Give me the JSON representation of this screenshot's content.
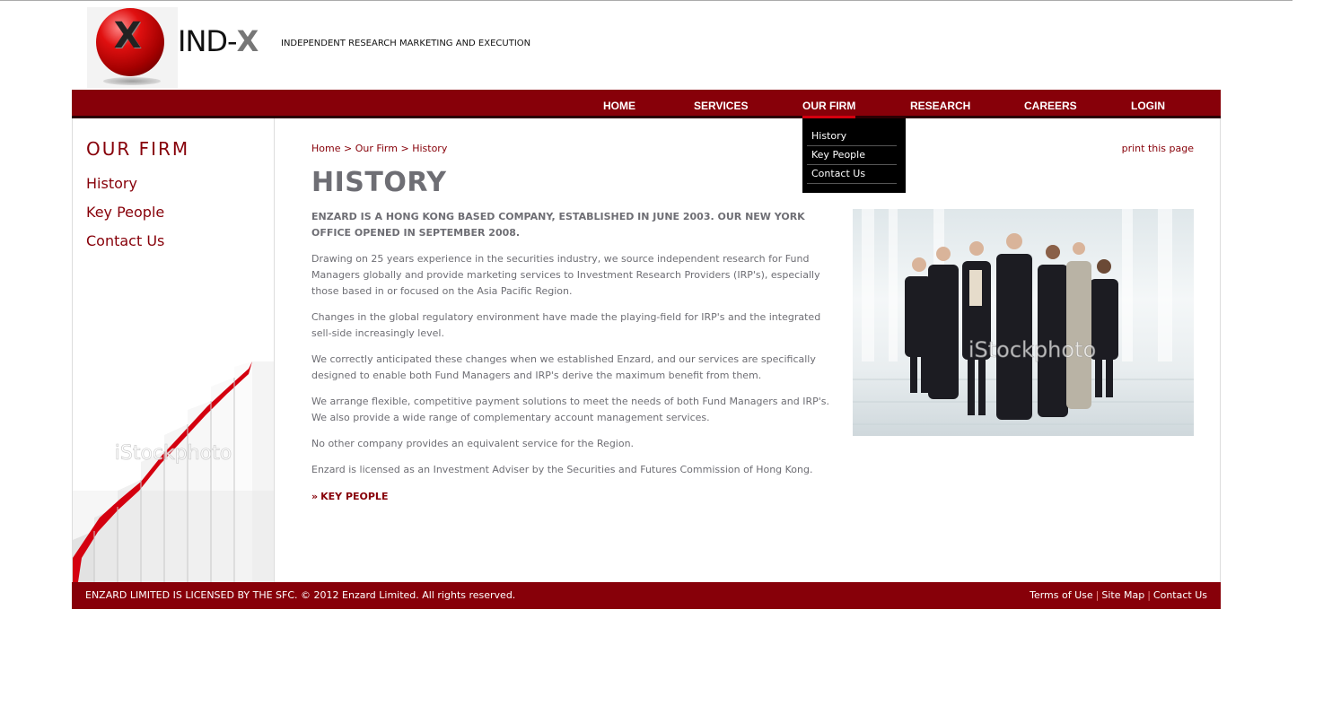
{
  "header": {
    "logo_mark": "X",
    "logo_name_main": "IND-",
    "logo_name_x": "X",
    "tagline": "INDEPENDENT RESEARCH MARKETING AND EXECUTION"
  },
  "nav": {
    "items": [
      {
        "label": "HOME"
      },
      {
        "label": "SERVICES"
      },
      {
        "label": "OUR FIRM",
        "active": true
      },
      {
        "label": "RESEARCH"
      },
      {
        "label": "CAREERS"
      },
      {
        "label": "LOGIN"
      }
    ],
    "dropdown": [
      "History",
      "Key People",
      "Contact Us"
    ]
  },
  "sidebar": {
    "title": "OUR FIRM",
    "links": [
      "History",
      "Key People",
      "Contact Us"
    ],
    "watermark": "iStockphoto"
  },
  "breadcrumb": {
    "home": "Home",
    "sep1": " > ",
    "section": "Our Firm",
    "sep2": " > ",
    "current": "History"
  },
  "print_label": "print this page",
  "page_title": "HISTORY",
  "lead": "ENZARD IS A HONG KONG BASED COMPANY, ESTABLISHED IN JUNE 2003. OUR NEW YORK OFFICE OPENED IN SEPTEMBER 2008.",
  "paragraphs": [
    "Drawing on 25 years experience in the securities industry, we source independent research for Fund Managers globally and provide marketing services to Investment Research Providers (IRP's), especially those based in or focused on the Asia Pacific Region.",
    "Changes in the global regulatory environment have made the playing-field for IRP's and the integrated sell-side increasingly level.",
    "We correctly anticipated these changes when we established Enzard, and our services are specifically designed to enable both Fund Managers and IRP's derive the maximum benefit from them.",
    "We arrange flexible, competitive payment solutions to meet the needs of both Fund Managers and IRP's. We also provide a wide range of complementary account management services.",
    "No other company provides an equivalent service for the Region.",
    "Enzard is licensed as an Investment Adviser by the Securities and Futures Commission of Hong Kong."
  ],
  "more_link": {
    "arrow": "»",
    "label": "KEY PEOPLE"
  },
  "photo_watermark": "iStockphoto",
  "footer": {
    "left": "ENZARD LIMITED IS LICENSED BY THE SFC. © 2012 Enzard Limited. All rights reserved.",
    "links": [
      "Terms of Use",
      "Site Map",
      "Contact Us"
    ],
    "separator": "|"
  },
  "colors": {
    "brand": "#870009",
    "text": "#6e6e74",
    "dropdown_bg": "#000000"
  }
}
